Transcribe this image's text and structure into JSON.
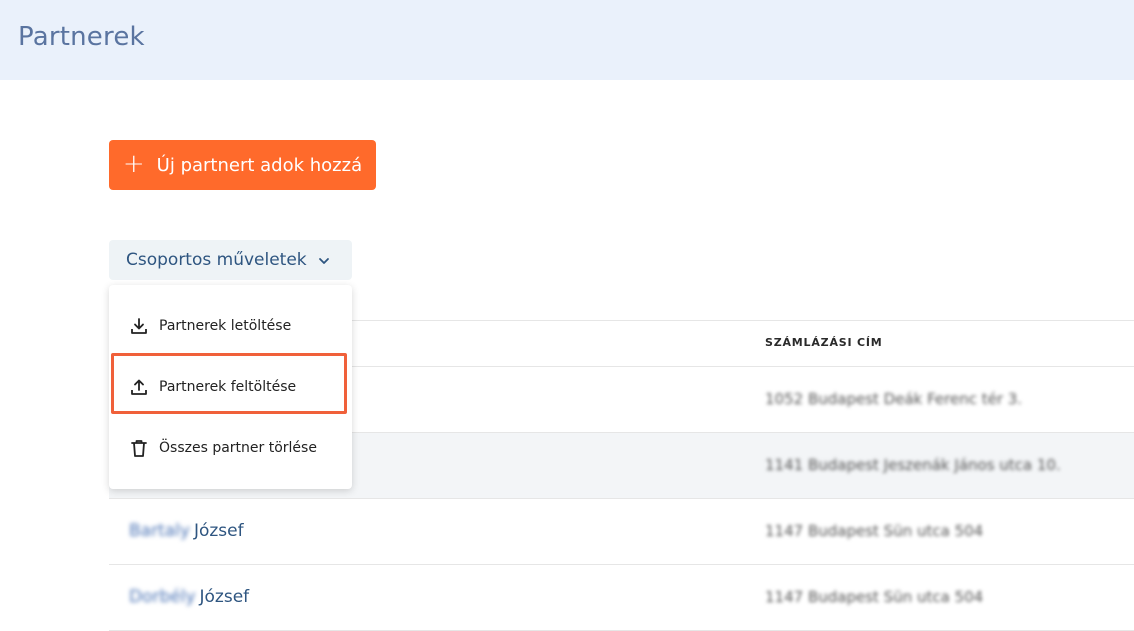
{
  "header": {
    "title": "Partnerek"
  },
  "actions": {
    "add_partner_label": "Új partnert adok hozzá",
    "bulk_actions_label": "Csoportos műveletek"
  },
  "bulk_menu": {
    "items": [
      {
        "label": "Partnerek letöltése",
        "icon": "download-icon"
      },
      {
        "label": "Partnerek feltöltése",
        "icon": "upload-icon"
      },
      {
        "label": "Összes partner törlése",
        "icon": "trash-icon"
      }
    ]
  },
  "table": {
    "columns": [
      "SZÁMLÁZÁSI CÍM"
    ],
    "rows": [
      {
        "name_first": "",
        "name_last": "",
        "address": "1052 Budapest Deák Ferenc tér 3."
      },
      {
        "name_first": "",
        "name_last": "",
        "address": "1141 Budapest Jeszenák János utca 10."
      },
      {
        "name_first": "Bartaly",
        "name_last": "József",
        "address": "1147 Budapest Sün utca 504"
      },
      {
        "name_first": "Dorbély",
        "name_last": "József",
        "address": "1147 Budapest Sün utca 504"
      }
    ]
  },
  "colors": {
    "accent": "#ff6a2b",
    "highlight": "#f0603a",
    "link": "#2e5580"
  }
}
